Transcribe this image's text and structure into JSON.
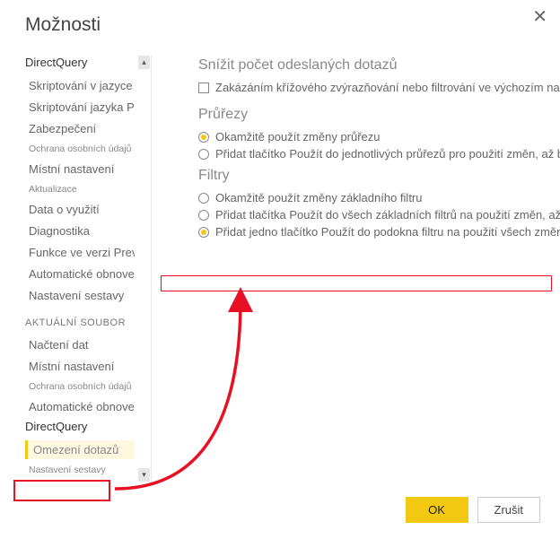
{
  "dialog": {
    "title": "Možnosti"
  },
  "sidebar": {
    "items": [
      {
        "label": "DirectQuery"
      },
      {
        "label": "Skriptování v jazyce R"
      },
      {
        "label": "Skriptování jazyka Python"
      },
      {
        "label": "Zabezpečení"
      },
      {
        "label": "Ochrana osobních údajů"
      },
      {
        "label": "Místní nastavení"
      },
      {
        "label": "Aktualizace"
      },
      {
        "label": "Data o využití"
      },
      {
        "label": "Diagnostika"
      },
      {
        "label": "Funkce ve verzi Preview"
      },
      {
        "label": "Automatické obnovení"
      },
      {
        "label": "Nastavení sestavy"
      }
    ],
    "section_label": "AKTUÁLNÍ SOUBOR",
    "items2": [
      {
        "label": "Načtení dat"
      },
      {
        "label": "Místní nastavení"
      },
      {
        "label": "Ochrana osobních údajů"
      },
      {
        "label": "Automatické obnovení"
      },
      {
        "label": "DirectQuery"
      },
      {
        "label": "Omezení dotazů"
      },
      {
        "label": "Nastavení sestavy"
      }
    ]
  },
  "content": {
    "sections": [
      {
        "title": "Snížit počet odeslaných dotazů",
        "checkbox": "Zakázáním křížového zvýrazňování nebo filtrování ve výchozím nastavení"
      },
      {
        "title": "Průřezy",
        "options": [
          "Okamžitě použít změny průřezu",
          "Přidat tlačítko Použít do jednotlivých průřezů pro použití změn, až budete"
        ]
      },
      {
        "title": "Filtry",
        "options": [
          "Okamžitě použít změny základního filtru",
          "Přidat tlačítka Použít do všech základních filtrů na použití změn, až budete připraveni",
          "Přidat jedno tlačítko Použít do podokna filtru na použití všech změn najednou"
        ]
      }
    ]
  },
  "footer": {
    "ok": "OK",
    "cancel": "Zrušit"
  },
  "colors": {
    "accent": "#f2c811",
    "annotation": "#e81123"
  }
}
